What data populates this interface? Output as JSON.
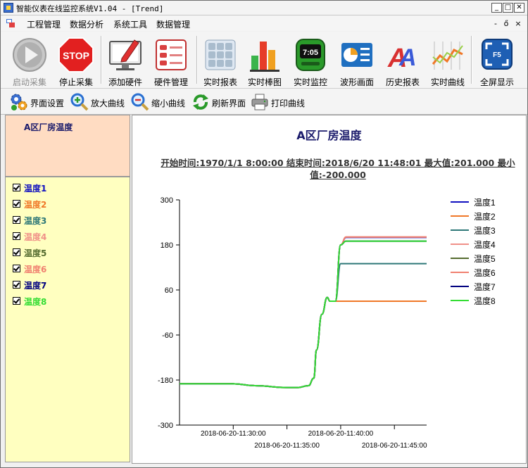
{
  "window": {
    "title": "智能仪表在线监控系统V1.04 - [Trend]",
    "min_glyph": "_",
    "max_glyph": "□",
    "close_glyph": "✕"
  },
  "menu": {
    "items": [
      "工程管理",
      "数据分析",
      "系统工具",
      "数据管理"
    ],
    "mdi_min": "-",
    "mdi_restore": "ő",
    "mdi_close": "×"
  },
  "toolbar": {
    "buttons": [
      {
        "label": "启动采集",
        "icon": "play-icon",
        "disabled": true
      },
      {
        "label": "停止采集",
        "icon": "stop-sign-icon",
        "stop_text": "STOP"
      },
      {
        "label": "添加硬件",
        "icon": "monitor-pencil-icon"
      },
      {
        "label": "硬件管理",
        "icon": "form-list-icon"
      },
      {
        "label": "实时报表",
        "icon": "grid-report-icon"
      },
      {
        "label": "实时棒图",
        "icon": "bar-chart-icon"
      },
      {
        "label": "实时监控",
        "icon": "digital-meter-icon",
        "meter_text": "7:05"
      },
      {
        "label": "波形画面",
        "icon": "waveform-icon"
      },
      {
        "label": "历史报表",
        "icon": "history-report-icon"
      },
      {
        "label": "实时曲线",
        "icon": "realtime-curve-icon"
      },
      {
        "label": "全屏显示",
        "icon": "fullscreen-icon",
        "key_text": "F5"
      }
    ]
  },
  "toolbar2": {
    "buttons": [
      {
        "label": "界面设置",
        "icon": "gears-icon"
      },
      {
        "label": "放大曲线",
        "icon": "zoom-in-icon"
      },
      {
        "label": "缩小曲线",
        "icon": "zoom-out-icon"
      },
      {
        "label": "刷新界面",
        "icon": "refresh-icon"
      },
      {
        "label": "打印曲线",
        "icon": "printer-icon"
      }
    ]
  },
  "sidebar": {
    "title": "A区厂房温度",
    "series": [
      {
        "label": "温度1",
        "checked": true,
        "color": "#1010c0"
      },
      {
        "label": "温度2",
        "checked": true,
        "color": "#f07828"
      },
      {
        "label": "温度3",
        "checked": true,
        "color": "#2e7878"
      },
      {
        "label": "温度4",
        "checked": true,
        "color": "#f09088"
      },
      {
        "label": "温度5",
        "checked": true,
        "color": "#556b2f"
      },
      {
        "label": "温度6",
        "checked": true,
        "color": "#f08070"
      },
      {
        "label": "温度7",
        "checked": true,
        "color": "#000080"
      },
      {
        "label": "温度8",
        "checked": true,
        "color": "#33dd33"
      }
    ]
  },
  "chart_data": {
    "type": "line",
    "title": "A区厂房温度",
    "subtitle": "开始时间:1970/1/1 8:00:00 结束时间:2018/6/20 11:48:01 最大值:201.000 最小值:-200.000",
    "xlabel": "",
    "ylabel": "",
    "ylim": [
      -300,
      300
    ],
    "yticks": [
      -300,
      -180,
      -60,
      60,
      180,
      300
    ],
    "xlim": [
      "2018-06-20-11:25:00",
      "2018-06-20-11:48:00"
    ],
    "xticks": [
      "2018-06-20-11:30:00",
      "2018-06-20-11:35:00",
      "2018-06-20-11:40:00",
      "2018-06-20-11:45:00"
    ],
    "grid": false,
    "legend_position": "right",
    "x": [
      "11:25:00",
      "11:30:00",
      "11:32:00",
      "11:35:00",
      "11:36:00",
      "11:37:00",
      "11:37:30",
      "11:37:45",
      "11:38:15",
      "11:38:45",
      "11:39:00",
      "11:39:30",
      "11:40:00",
      "11:40:30",
      "11:48:00"
    ],
    "series": [
      {
        "name": "温度1",
        "color": "#1010c0",
        "values": [
          -190,
          -190,
          -195,
          -200,
          -200,
          -195,
          -175,
          -100,
          -5,
          40,
          30,
          30,
          180,
          200,
          200
        ]
      },
      {
        "name": "温度2",
        "color": "#f07828",
        "values": [
          -190,
          -190,
          -195,
          -200,
          -200,
          -195,
          -175,
          -100,
          -5,
          40,
          30,
          30,
          30,
          30,
          30
        ]
      },
      {
        "name": "温度3",
        "color": "#2e7878",
        "values": [
          -190,
          -190,
          -195,
          -200,
          -200,
          -195,
          -175,
          -100,
          -5,
          40,
          30,
          30,
          130,
          130,
          130
        ]
      },
      {
        "name": "温度4",
        "color": "#f09088",
        "values": [
          -190,
          -190,
          -195,
          -200,
          -200,
          -195,
          -175,
          -100,
          -5,
          40,
          30,
          30,
          180,
          201,
          201
        ]
      },
      {
        "name": "温度5",
        "color": "#556b2f",
        "values": [
          -190,
          -190,
          -195,
          -200,
          -200,
          -195,
          -175,
          -100,
          -5,
          40,
          30,
          30,
          180,
          190,
          190
        ]
      },
      {
        "name": "温度6",
        "color": "#f08070",
        "values": [
          -190,
          -190,
          -195,
          -200,
          -200,
          -195,
          -175,
          -100,
          -5,
          40,
          30,
          30,
          180,
          201,
          201
        ]
      },
      {
        "name": "温度7",
        "color": "#000080",
        "values": [
          -190,
          -190,
          -195,
          -200,
          -200,
          -195,
          -175,
          -100,
          -5,
          40,
          30,
          30,
          180,
          190,
          190
        ]
      },
      {
        "name": "温度8",
        "color": "#33dd33",
        "values": [
          -190,
          -190,
          -195,
          -200,
          -200,
          -195,
          -175,
          -100,
          -5,
          40,
          30,
          30,
          180,
          190,
          190
        ]
      }
    ]
  }
}
